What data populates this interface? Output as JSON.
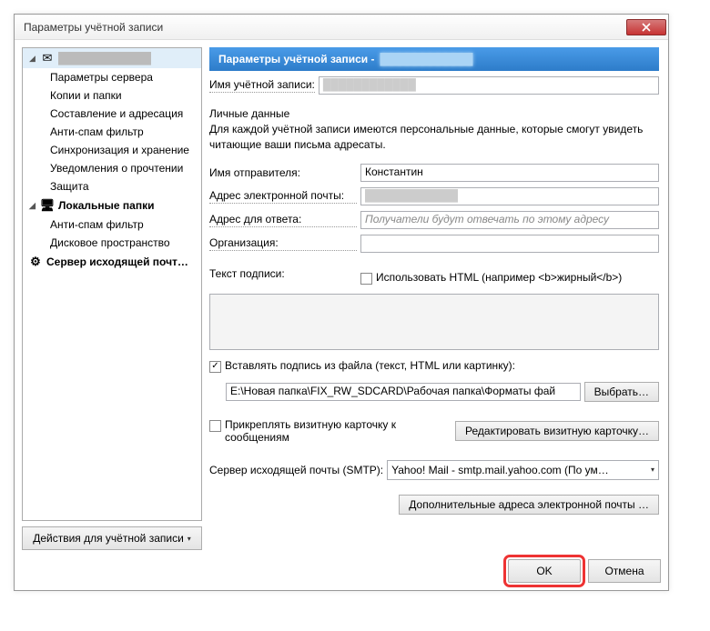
{
  "window": {
    "title": "Параметры учётной записи"
  },
  "tree": {
    "account_blur": "████████████",
    "items": [
      "Параметры сервера",
      "Копии и папки",
      "Составление и адресация",
      "Анти-спам фильтр",
      "Синхронизация и хранение",
      "Уведомления о прочтении",
      "Защита"
    ],
    "local_folders": "Локальные папки",
    "local_sub": [
      "Анти-спам фильтр",
      "Дисковое пространство"
    ],
    "smtp": "Сервер исходящей почт…"
  },
  "actions_btn": "Действия для учётной записи",
  "banner": {
    "title": "Параметры учётной записи -",
    "blur": "████████████"
  },
  "account_name_label": "Имя учётной записи:",
  "account_name_blur": "████████████",
  "personal": {
    "section": "Личные данные",
    "desc": "Для каждой учётной записи имеются персональные данные, которые смогут увидеть читающие ваши письма адресаты.",
    "sender_label": "Имя отправителя:",
    "sender_value": "Константин",
    "email_label": "Адрес электронной почты:",
    "email_blur": "████████████",
    "reply_label": "Адрес для ответа:",
    "reply_placeholder": "Получатели будут отвечать по этому адресу",
    "org_label": "Организация:",
    "org_value": ""
  },
  "signature": {
    "label": "Текст подписи:",
    "html_cb": "Использовать HTML (например <b>жирный</b>)",
    "from_file_cb": "Вставлять подпись из файла (текст, HTML или картинку):",
    "file_path": "E:\\Новая папка\\FIX_RW_SDCARD\\Рабочая папка\\Форматы фай",
    "choose_btn": "Выбрать…"
  },
  "vcard": {
    "cb": "Прикреплять визитную карточку к сообщениям",
    "edit_btn": "Редактировать визитную карточку…"
  },
  "smtp": {
    "label": "Сервер исходящей почты (SMTP):",
    "value": "Yahoo! Mail - smtp.mail.yahoo.com (По ум…"
  },
  "extra_btn": "Дополнительные адреса электронной почты …",
  "buttons": {
    "ok": "OK",
    "cancel": "Отмена"
  }
}
